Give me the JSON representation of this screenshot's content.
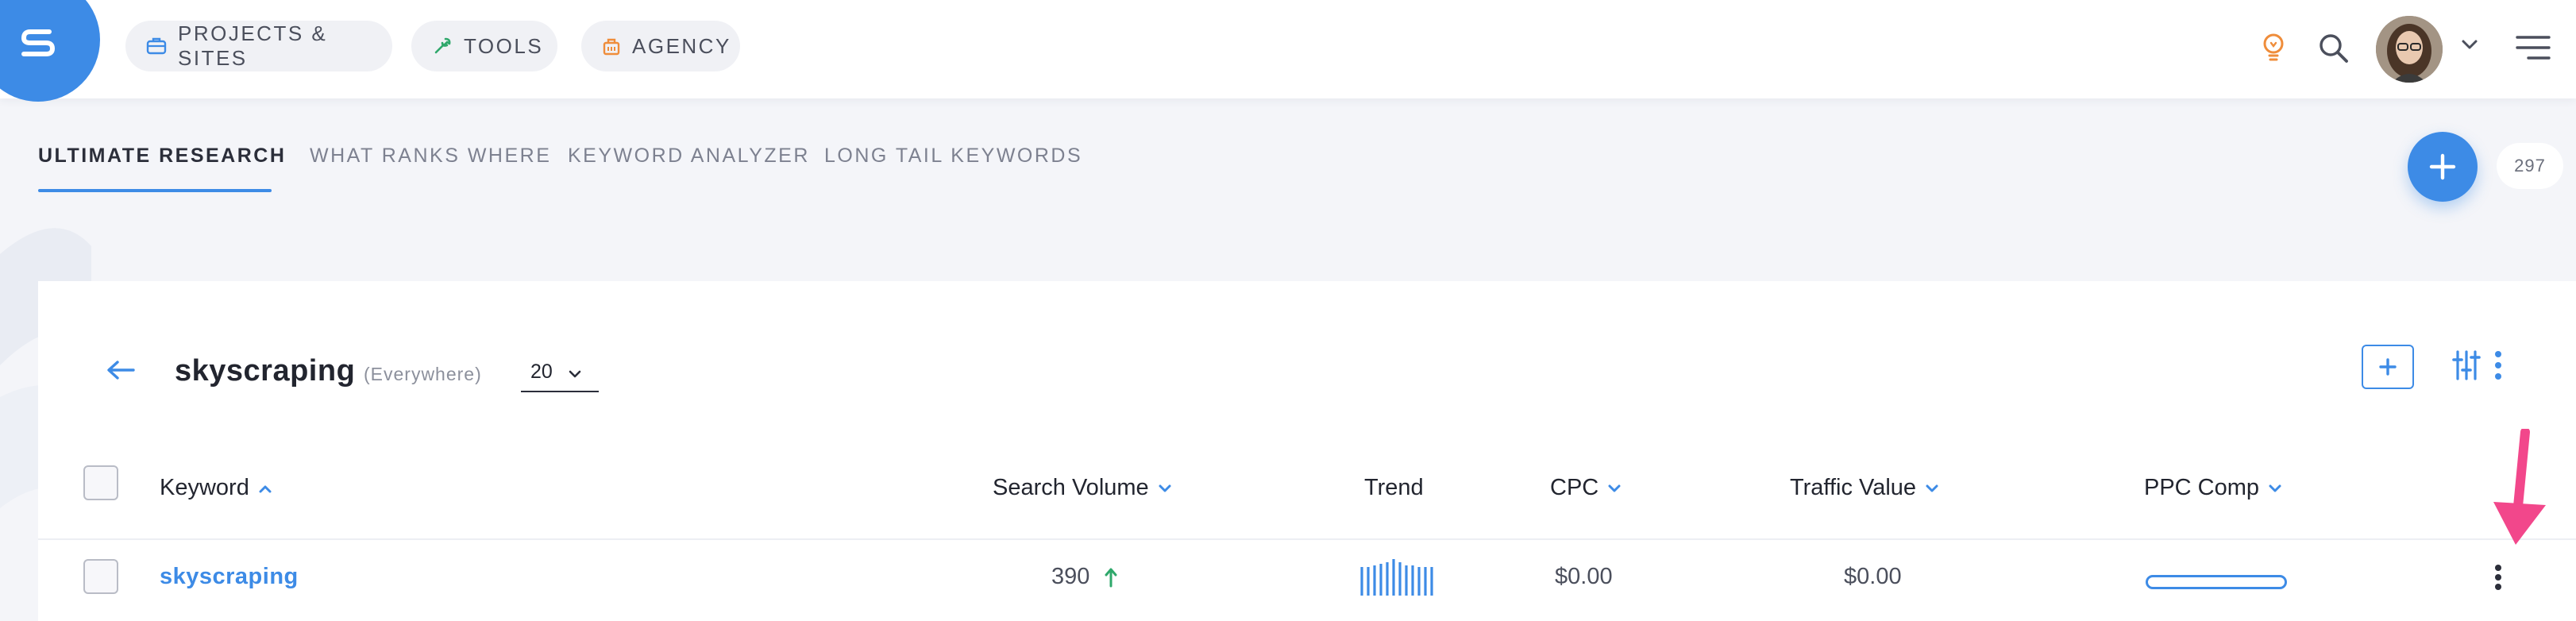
{
  "topbar": {
    "nav": [
      {
        "label": "PROJECTS & SITES",
        "icon": "briefcase-icon",
        "icon_color": "#3d8be6"
      },
      {
        "label": "TOOLS",
        "icon": "tools-icon",
        "icon_color": "#2fa86b"
      },
      {
        "label": "AGENCY",
        "icon": "agency-icon",
        "icon_color": "#ef8d3b"
      }
    ],
    "icons": [
      "lightbulb-icon",
      "search-icon",
      "avatar",
      "chevron-down-icon",
      "menu-icon"
    ]
  },
  "tabs": {
    "items": [
      "ULTIMATE RESEARCH",
      "WHAT RANKS WHERE",
      "KEYWORD ANALYZER",
      "LONG TAIL KEYWORDS"
    ],
    "active": "ULTIMATE RESEARCH",
    "count_badge": "297"
  },
  "card": {
    "keyword": "skyscraping",
    "location": "(Everywhere)",
    "per_page": "20",
    "columns": [
      "Keyword",
      "Search Volume",
      "Trend",
      "CPC",
      "Traffic Value",
      "PPC Comp"
    ],
    "rows": [
      {
        "keyword": "skyscraping",
        "search_volume": "390",
        "search_volume_trend": "up",
        "cpc": "$0.00",
        "traffic_value": "$0.00",
        "ppc_comp": 0
      }
    ]
  },
  "colors": {
    "accent": "#3d8be6",
    "up_green": "#2fa86b",
    "annotation_pink": "#f2478b",
    "bulb_orange": "#ef8d3b"
  }
}
